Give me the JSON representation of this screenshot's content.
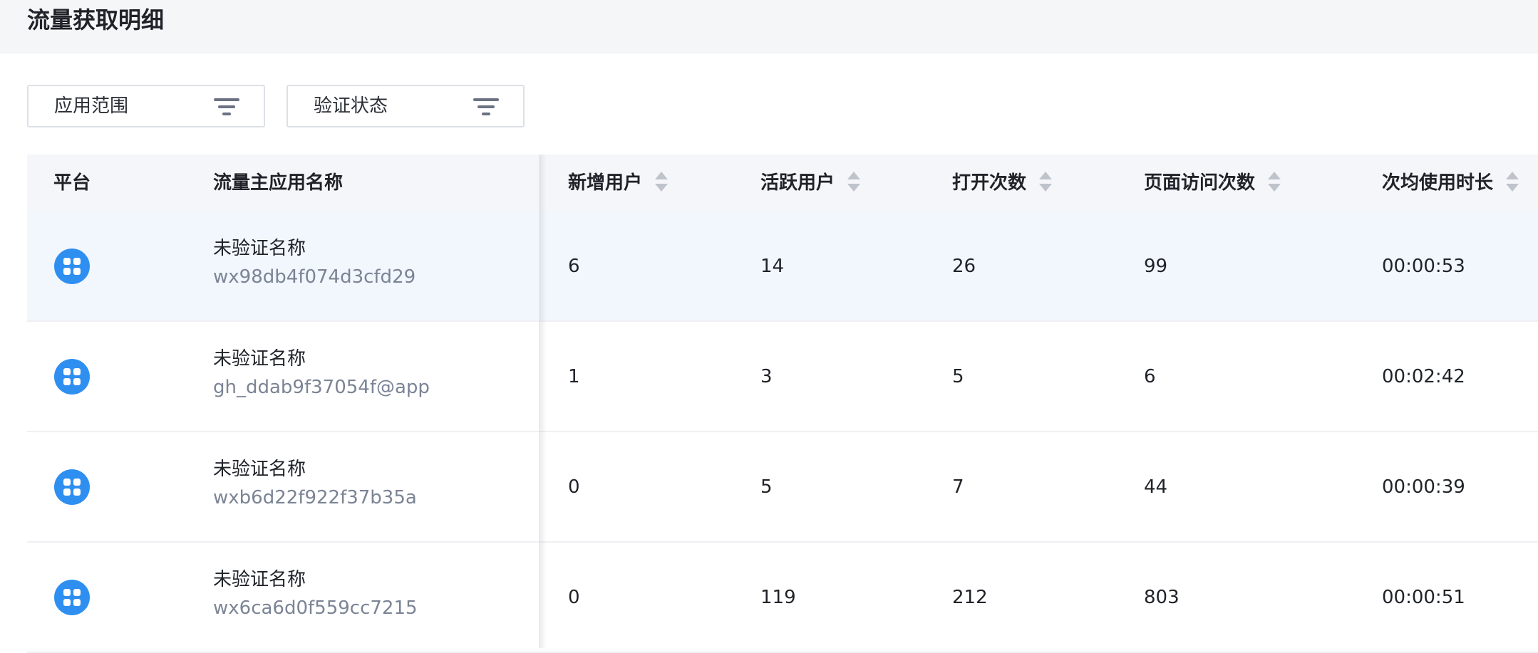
{
  "page": {
    "title": "流量获取明细"
  },
  "filters": [
    {
      "label": "应用范围",
      "icon": "filter-icon"
    },
    {
      "label": "验证状态",
      "icon": "filter-icon"
    }
  ],
  "table": {
    "columns": {
      "platform": "平台",
      "app": "流量主应用名称",
      "new_users": "新增用户",
      "active_users": "活跃用户",
      "opens": "打开次数",
      "page_views": "页面访问次数",
      "avg_duration": "次均使用时长"
    },
    "rows": [
      {
        "platform_icon": "mini-program-icon",
        "name": "未验证名称",
        "app_id": "wx98db4f074d3cfd29",
        "new_users": "6",
        "active_users": "14",
        "opens": "26",
        "page_views": "99",
        "avg_duration": "00:00:53"
      },
      {
        "platform_icon": "mini-program-icon",
        "name": "未验证名称",
        "app_id": "gh_ddab9f37054f@app",
        "new_users": "1",
        "active_users": "3",
        "opens": "5",
        "page_views": "6",
        "avg_duration": "00:02:42"
      },
      {
        "platform_icon": "mini-program-icon",
        "name": "未验证名称",
        "app_id": "wxb6d22f922f37b35a",
        "new_users": "0",
        "active_users": "5",
        "opens": "7",
        "page_views": "44",
        "avg_duration": "00:00:39"
      },
      {
        "platform_icon": "mini-program-icon",
        "name": "未验证名称",
        "app_id": "wx6ca6d0f559cc7215",
        "new_users": "0",
        "active_users": "119",
        "opens": "212",
        "page_views": "803",
        "avg_duration": "00:00:51"
      }
    ]
  },
  "colors": {
    "accent": "#2f8ff0",
    "header_bg": "#f5f6f8",
    "highlight_row": "#f2f6fd",
    "secondary_text": "#7b8495"
  }
}
